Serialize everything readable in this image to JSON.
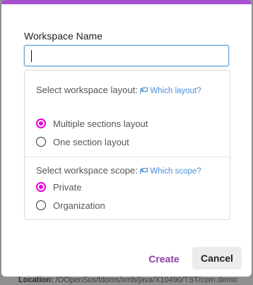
{
  "background": {
    "location_label": "Location:",
    "location_value": "/OOpenSus/tdoms/xmb/java/X10490/TST/com.demo"
  },
  "dialog": {
    "accent_color": "#a64fd1",
    "name_field": {
      "label": "Workspace Name",
      "value": "",
      "placeholder": ""
    },
    "layout_section": {
      "heading": "Select workspace layout:",
      "help_link": "Which layout?",
      "help_icon": "presenter-icon",
      "options": [
        {
          "label": "Multiple sections layout",
          "checked": true
        },
        {
          "label": "One section layout",
          "checked": false
        }
      ]
    },
    "scope_section": {
      "heading": "Select workspace scope:",
      "help_link": "Which scope?",
      "help_icon": "presenter-icon",
      "options": [
        {
          "label": "Private",
          "checked": true
        },
        {
          "label": "Organization",
          "checked": false
        }
      ]
    },
    "buttons": {
      "create": "Create",
      "cancel": "Cancel"
    },
    "radio_color": "#e600d7",
    "link_color": "#4a8ed6"
  }
}
